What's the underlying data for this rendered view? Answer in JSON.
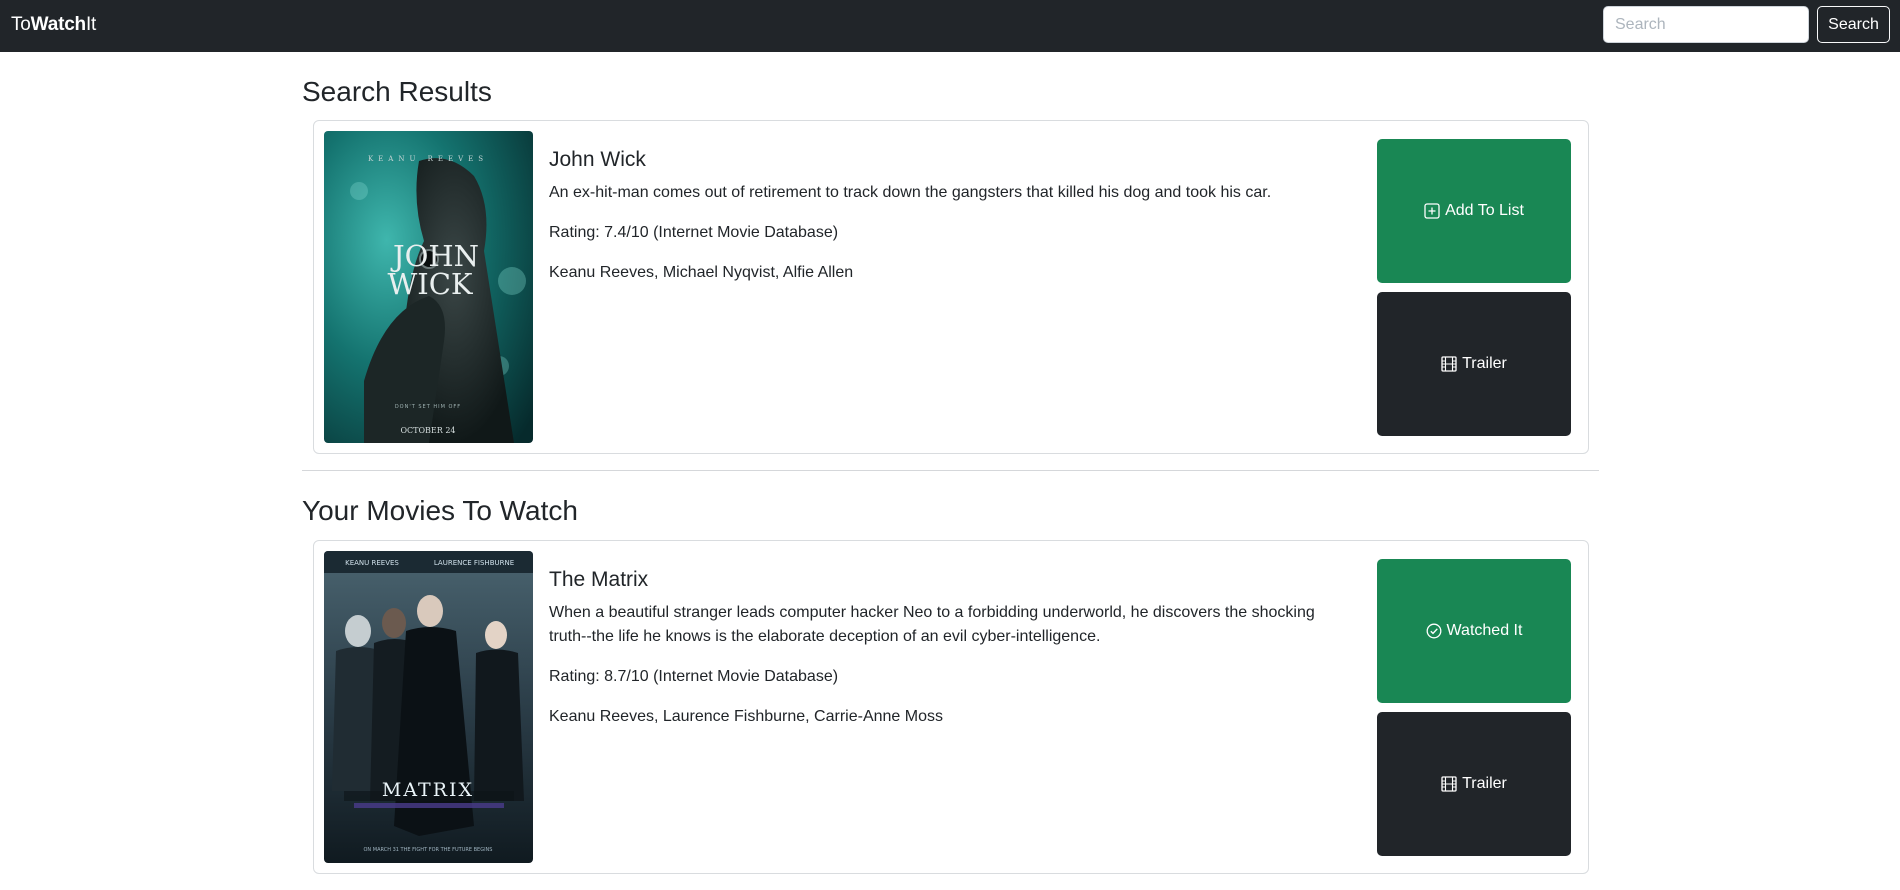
{
  "navbar": {
    "brand_prefix": "To",
    "brand_bold": "Watch",
    "brand_suffix": "It",
    "search_placeholder": "Search",
    "search_button": "Search"
  },
  "search_results": {
    "heading": "Search Results",
    "movies": [
      {
        "title": "John Wick",
        "plot": "An ex-hit-man comes out of retirement to track down the gangsters that killed his dog and took his car.",
        "rating": "Rating: 7.4/10 (Internet Movie Database)",
        "cast": "Keanu Reeves, Michael Nyqvist, Alfie Allen",
        "primary_action": "Add To List",
        "secondary_action": "Trailer",
        "poster": {
          "top_text": "KEANU REEVES",
          "title_line1": "JOHN",
          "title_line2": "WICK",
          "tagline": "DON'T SET HIM OFF",
          "date": "OCTOBER 24"
        }
      }
    ]
  },
  "watch_list": {
    "heading": "Your Movies To Watch",
    "movies": [
      {
        "title": "The Matrix",
        "plot": "When a beautiful stranger leads computer hacker Neo to a forbidding underworld, he discovers the shocking truth--the life he knows is the elaborate deception of an evil cyber-intelligence.",
        "rating": "Rating: 8.7/10 (Internet Movie Database)",
        "cast": "Keanu Reeves, Laurence Fishburne, Carrie-Anne Moss",
        "primary_action": "Watched It",
        "secondary_action": "Trailer",
        "poster": {
          "top_text_left": "KEANU REEVES",
          "top_text_right": "LAURENCE FISHBURNE",
          "title": "MATRIX",
          "tagline": "ON MARCH 31 THE FIGHT FOR THE FUTURE BEGINS"
        }
      }
    ]
  },
  "colors": {
    "navbar": "#212529",
    "success": "#198754",
    "dark": "#212529"
  }
}
